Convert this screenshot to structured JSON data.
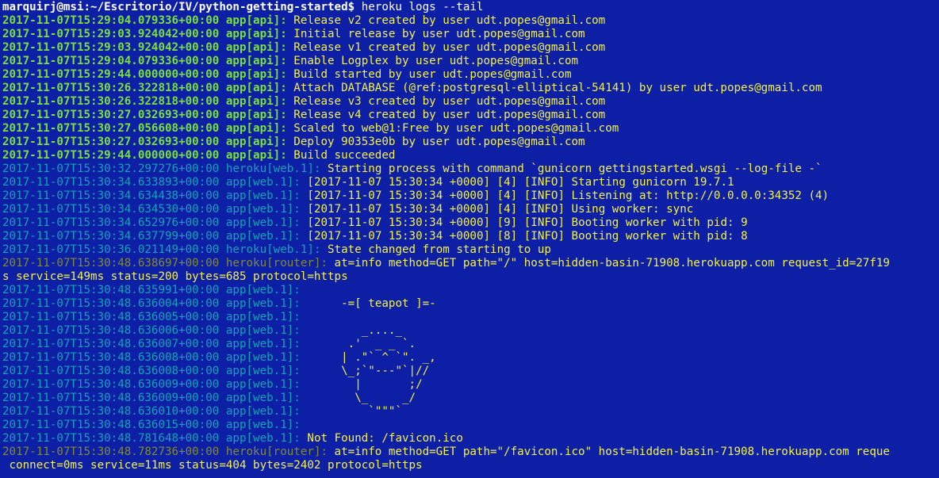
{
  "window": {
    "prompt": "marquirj@msi:~/Escritorio/IV/python-getting-started$",
    "command": " heroku logs --tail"
  },
  "colors": {
    "background": "#0c1fa5",
    "api_prefix": "#7be03c",
    "web_prefix": "#14a3b7",
    "router_prefix": "#838b2e",
    "output_text": "#f4f14a"
  },
  "api_lines": [
    {
      "ts": "2017-11-07T15:29:04.079336+00:00",
      "src": "app[api]:",
      "msg": " Release v2 created by user udt.popes@gmail.com"
    },
    {
      "ts": "2017-11-07T15:29:03.924042+00:00",
      "src": "app[api]:",
      "msg": " Initial release by user udt.popes@gmail.com"
    },
    {
      "ts": "2017-11-07T15:29:03.924042+00:00",
      "src": "app[api]:",
      "msg": " Release v1 created by user udt.popes@gmail.com"
    },
    {
      "ts": "2017-11-07T15:29:04.079336+00:00",
      "src": "app[api]:",
      "msg": " Enable Logplex by user udt.popes@gmail.com"
    },
    {
      "ts": "2017-11-07T15:29:44.000000+00:00",
      "src": "app[api]:",
      "msg": " Build started by user udt.popes@gmail.com"
    },
    {
      "ts": "2017-11-07T15:30:26.322818+00:00",
      "src": "app[api]:",
      "msg": " Attach DATABASE (@ref:postgresql-elliptical-54141) by user udt.popes@gmail.com"
    },
    {
      "ts": "2017-11-07T15:30:26.322818+00:00",
      "src": "app[api]:",
      "msg": " Release v3 created by user udt.popes@gmail.com"
    },
    {
      "ts": "2017-11-07T15:30:27.032693+00:00",
      "src": "app[api]:",
      "msg": " Release v4 created by user udt.popes@gmail.com"
    },
    {
      "ts": "2017-11-07T15:30:27.056608+00:00",
      "src": "app[api]:",
      "msg": " Scaled to web@1:Free by user udt.popes@gmail.com"
    },
    {
      "ts": "2017-11-07T15:30:27.032693+00:00",
      "src": "app[api]:",
      "msg": " Deploy 90353e0b by user udt.popes@gmail.com"
    },
    {
      "ts": "2017-11-07T15:29:44.000000+00:00",
      "src": "app[api]:",
      "msg": " Build succeeded"
    }
  ],
  "web_lines": [
    {
      "ts": "2017-11-07T15:30:32.297276+00:00",
      "src": "heroku[web.1]:",
      "msg": " Starting process with command `gunicorn gettingstarted.wsgi --log-file -`"
    },
    {
      "ts": "2017-11-07T15:30:34.633893+00:00",
      "src": "app[web.1]:",
      "msg": " [2017-11-07 15:30:34 +0000] [4] [INFO] Starting gunicorn 19.7.1"
    },
    {
      "ts": "2017-11-07T15:30:34.634438+00:00",
      "src": "app[web.1]:",
      "msg": " [2017-11-07 15:30:34 +0000] [4] [INFO] Listening at: http://0.0.0.0:34352 (4)"
    },
    {
      "ts": "2017-11-07T15:30:34.634530+00:00",
      "src": "app[web.1]:",
      "msg": " [2017-11-07 15:30:34 +0000] [4] [INFO] Using worker: sync"
    },
    {
      "ts": "2017-11-07T15:30:34.652976+00:00",
      "src": "app[web.1]:",
      "msg": " [2017-11-07 15:30:34 +0000] [9] [INFO] Booting worker with pid: 9"
    },
    {
      "ts": "2017-11-07T15:30:34.637799+00:00",
      "src": "app[web.1]:",
      "msg": " [2017-11-07 15:30:34 +0000] [8] [INFO] Booting worker with pid: 8"
    },
    {
      "ts": "2017-11-07T15:30:36.021149+00:00",
      "src": "heroku[web.1]:",
      "msg": " State changed from starting to up"
    }
  ],
  "router_line_1": {
    "ts": "2017-11-07T15:30:48.638697+00:00",
    "src": "heroku[router]:",
    "msg": " at=info method=GET path=\"/\" host=hidden-basin-71908.herokuapp.com request_id=27f19",
    "wrap": "s service=149ms status=200 bytes=685 protocol=https"
  },
  "teapot_lines": [
    {
      "ts": "2017-11-07T15:30:48.635991+00:00",
      "src": "app[web.1]:",
      "art": ""
    },
    {
      "ts": "2017-11-07T15:30:48.636004+00:00",
      "src": "app[web.1]:",
      "art": "     -=[ teapot ]=-"
    },
    {
      "ts": "2017-11-07T15:30:48.636005+00:00",
      "src": "app[web.1]:",
      "art": ""
    },
    {
      "ts": "2017-11-07T15:30:48.636006+00:00",
      "src": "app[web.1]:",
      "art": "        _...._"
    },
    {
      "ts": "2017-11-07T15:30:48.636007+00:00",
      "src": "app[web.1]:",
      "art": "      .'  _ _ `."
    },
    {
      "ts": "2017-11-07T15:30:48.636008+00:00",
      "src": "app[web.1]:",
      "art": "     | .\"` ^ `\". _,"
    },
    {
      "ts": "2017-11-07T15:30:48.636008+00:00",
      "src": "app[web.1]:",
      "art": "     \\_;`\"---\"`|//"
    },
    {
      "ts": "2017-11-07T15:30:48.636009+00:00",
      "src": "app[web.1]:",
      "art": "       |       ;/"
    },
    {
      "ts": "2017-11-07T15:30:48.636009+00:00",
      "src": "app[web.1]:",
      "art": "       \\_     _/"
    },
    {
      "ts": "2017-11-07T15:30:48.636010+00:00",
      "src": "app[web.1]:",
      "art": "         `\"\"\"`"
    },
    {
      "ts": "2017-11-07T15:30:48.636015+00:00",
      "src": "app[web.1]:",
      "art": ""
    }
  ],
  "favicon_line": {
    "ts": "2017-11-07T15:30:48.781648+00:00",
    "src": "app[web.1]:",
    "msg": " Not Found: /favicon.ico"
  },
  "router_line_2": {
    "ts": "2017-11-07T15:30:48.782736+00:00",
    "src": "heroku[router]:",
    "msg": " at=info method=GET path=\"/favicon.ico\" host=hidden-basin-71908.herokuapp.com reque",
    "wrap": " connect=0ms service=11ms status=404 bytes=2402 protocol=https"
  }
}
